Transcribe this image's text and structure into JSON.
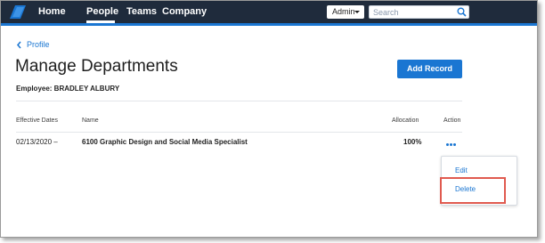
{
  "nav": {
    "links": [
      "Home",
      "People",
      "Teams",
      "Company"
    ],
    "active": "People",
    "admin_label": "Admin",
    "search_placeholder": "Search"
  },
  "page": {
    "back_label": "Profile",
    "title": "Manage Departments",
    "add_button": "Add Record",
    "employee": "Employee: BRADLEY ALBURY"
  },
  "table": {
    "headers": [
      "Effective Dates",
      "Name",
      "Allocation",
      "Action"
    ],
    "rows": [
      {
        "date": "02/13/2020 –",
        "name": "6100 Graphic Design and Social Media Specialist",
        "allocation": "100%"
      }
    ]
  },
  "action_menu": {
    "items": [
      "Edit",
      "Delete"
    ],
    "highlighted": "Delete"
  },
  "colors": {
    "nav_bg": "#1f2b3c",
    "accent": "#1a76d2",
    "highlight_border": "#e05a4f"
  }
}
